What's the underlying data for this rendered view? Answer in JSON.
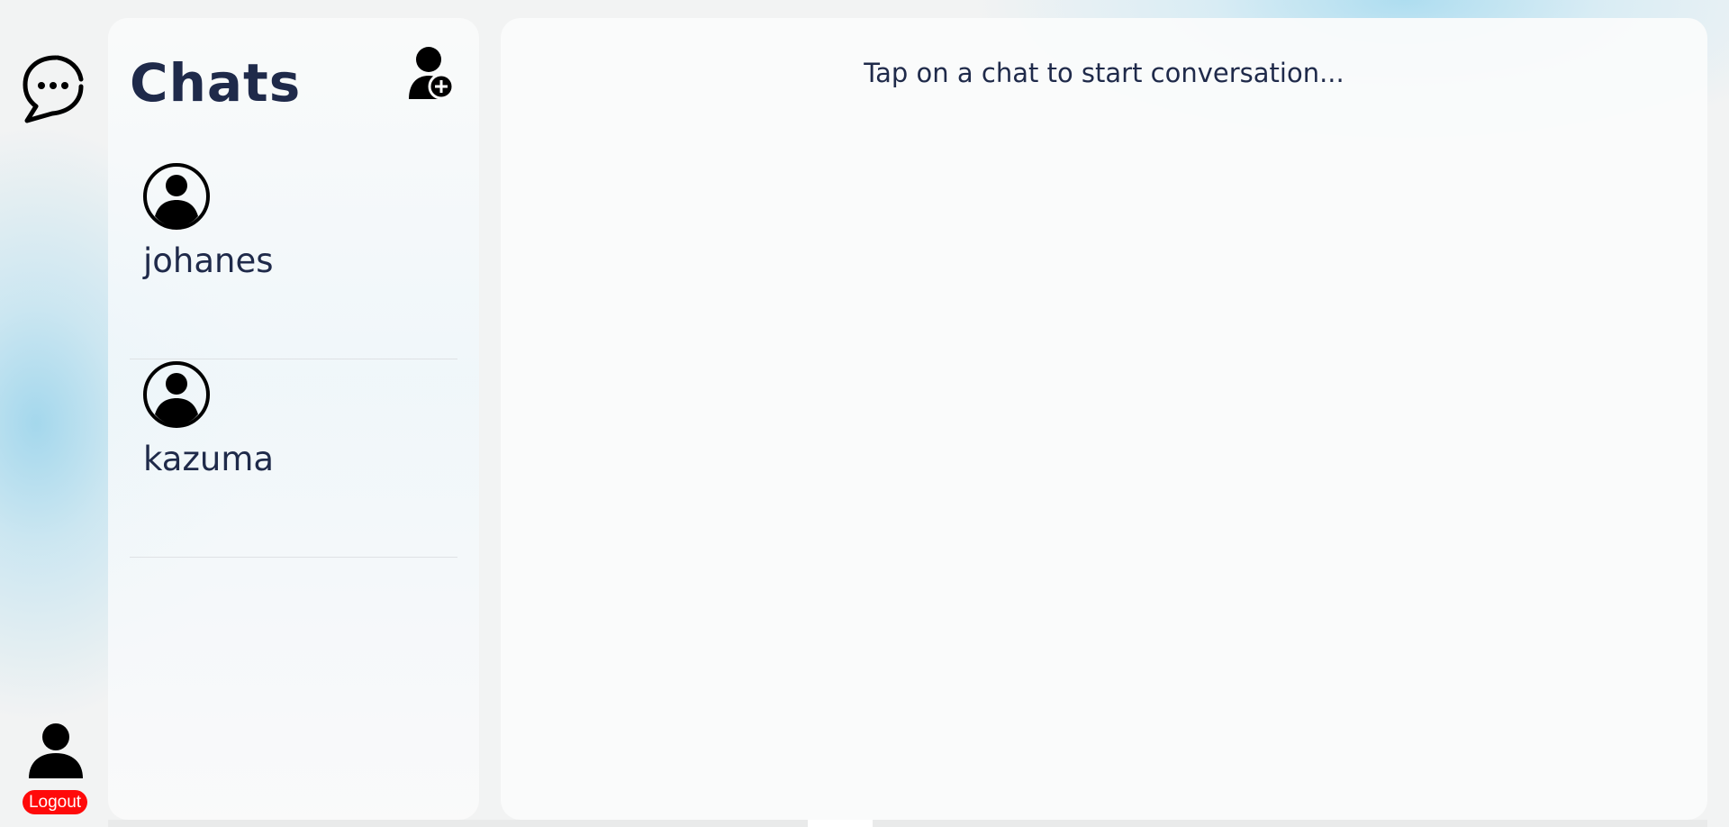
{
  "sidebar": {
    "logo_icon": "chat-bubble-dots-icon",
    "profile_icon": "user-icon",
    "logout_label": "Logout"
  },
  "chats": {
    "title": "Chats",
    "add_icon": "add-user-icon",
    "items": [
      {
        "name": "johanes",
        "avatar_icon": "user-circle-icon"
      },
      {
        "name": "kazuma",
        "avatar_icon": "user-circle-icon"
      }
    ]
  },
  "conversation": {
    "placeholder": "Tap on a chat to start conversation..."
  },
  "colors": {
    "text": "#1f2a4a",
    "logout": "#ff0a0a"
  }
}
